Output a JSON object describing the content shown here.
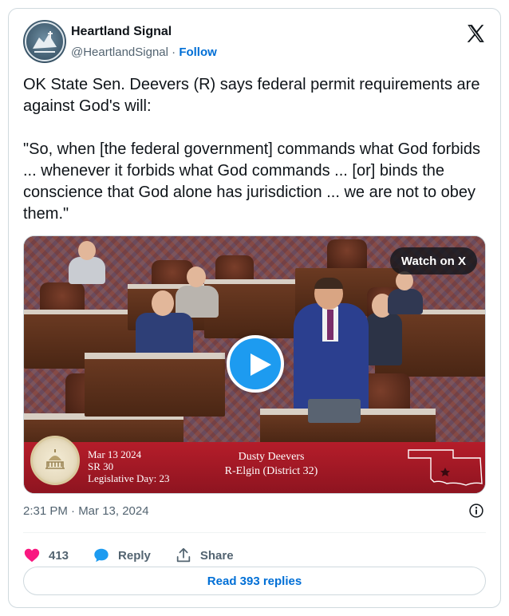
{
  "author": {
    "name": "Heartland Signal",
    "handle": "@HeartlandSignal",
    "separator": "·",
    "follow_label": "Follow"
  },
  "tweet": {
    "text": "OK State Sen. Deevers (R) says federal permit requirements are against God's will:\n\n\"So, when [the federal government] commands what God forbids ... whenever it forbids what God commands ... [or] binds the conscience that God alone has jurisdiction ... we are not to obey them.\""
  },
  "media": {
    "watch_label": "Watch on X",
    "lower_third": {
      "date": "Mar 13 2024",
      "resolution": "SR 30",
      "legislative_day": "Legislative Day: 23",
      "speaker_name": "Dusty Deevers",
      "speaker_district": "R-Elgin (District 32)"
    }
  },
  "timestamp": "2:31 PM · Mar 13, 2024",
  "actions": {
    "like_count": "413",
    "reply_label": "Reply",
    "share_label": "Share"
  },
  "read_replies_label": "Read 393 replies",
  "icons": {
    "brand": "x-logo-icon",
    "info": "info-icon",
    "like": "heart-icon",
    "reply": "speech-bubble-icon",
    "share": "share-upload-icon",
    "play": "play-icon"
  },
  "colors": {
    "link": "#006fd6",
    "play": "#1d9bf0",
    "like": "#f91880",
    "muted": "#536471",
    "lower_third": "#b51d2a"
  }
}
